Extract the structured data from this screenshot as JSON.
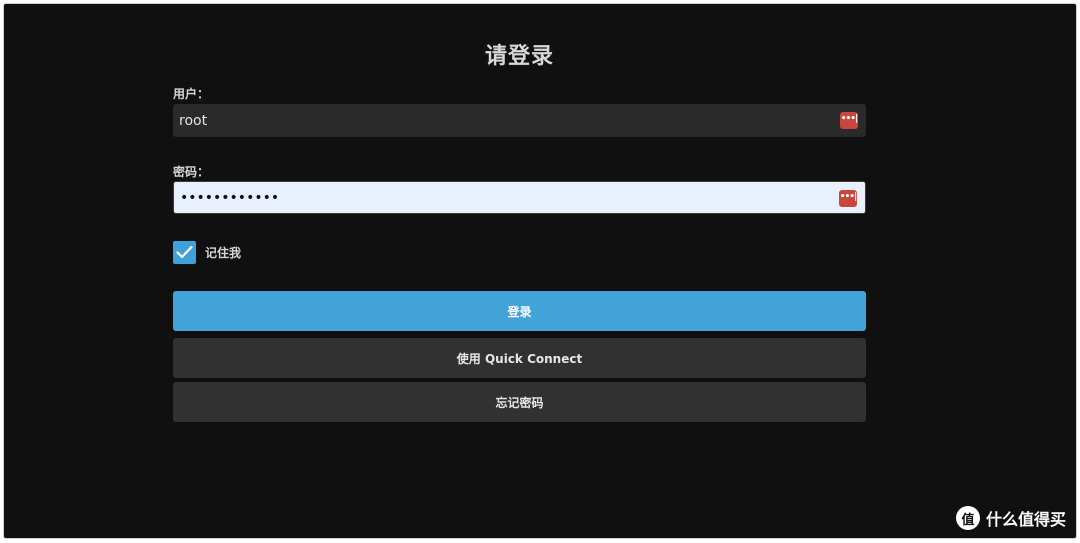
{
  "title": "请登录",
  "username": {
    "label": "用户：",
    "value": "root"
  },
  "password": {
    "label": "密码：",
    "value": "••••••••••••"
  },
  "remember": {
    "label": "记住我",
    "checked": true
  },
  "buttons": {
    "login": "登录",
    "quick_connect": "使用 Quick Connect",
    "forgot": "忘记密码"
  },
  "icons": {
    "password_manager": "password-manager-icon",
    "checkmark": "check-icon"
  },
  "colors": {
    "background": "#101010",
    "primary_button": "#42a3d9",
    "secondary_button": "#313131",
    "input_dark": "#2a2a2a",
    "input_autofill": "#e8f0fe",
    "password_icon": "#c9463d",
    "checkbox": "#3ea1d9"
  },
  "watermark": {
    "text": "什么值得买",
    "logo_text": "值"
  }
}
